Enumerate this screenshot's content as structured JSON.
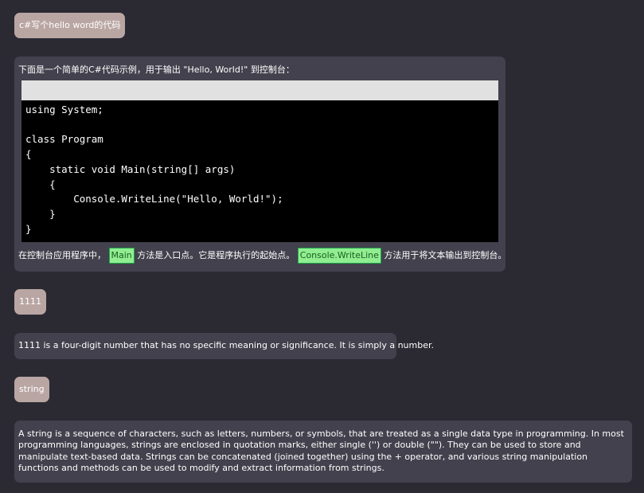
{
  "messages": {
    "q1": "c#写个hello word的代码",
    "a1_intro": "下面是一个简单的C#代码示例，用于输出 \"Hello, World!\" 到控制台：",
    "a1_code": "using System;\n\nclass Program\n{\n    static void Main(string[] args)\n    {\n        Console.WriteLine(\"Hello, World!\");\n    }\n}",
    "a1_outro_part1": "在控制台应用程序中，",
    "a1_outro_code1": "Main",
    "a1_outro_part2": "方法是入口点。它是程序执行的起始点。",
    "a1_outro_code2": "Console.WriteLine",
    "a1_outro_part3": "方法用于将文本输出到控制台。",
    "q2": "1111",
    "a2": "1111 is a four-digit number that has no specific meaning or significance. It is simply a number.",
    "q3": "string",
    "a3": "A string is a sequence of characters, such as letters, numbers, or symbols, that are treated as a single data type in programming. In most programming languages, strings are enclosed in quotation marks, either single ('') or double (\"\"). They can be used to store and manipulate text-based data. Strings can be concatenated (joined together) using the + operator, and various string manipulation functions and methods can be used to modify and extract information from strings."
  },
  "colors": {
    "background": "#2b2a33",
    "user_bubble": "#b9a6a3",
    "bot_bubble": "#42414d",
    "code_background": "#000000",
    "code_header": "#e1e1e1",
    "inline_code_bg": "#90ee90"
  }
}
